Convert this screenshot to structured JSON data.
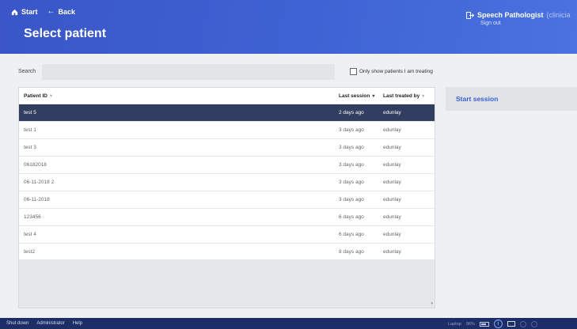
{
  "header": {
    "nav": {
      "start_label": "Start",
      "back_label": "Back"
    },
    "title": "Select patient",
    "user": {
      "name": "Speech Pathologist",
      "role": "(clinicia",
      "signout_label": "Sign out"
    }
  },
  "search": {
    "label": "Search",
    "value": "",
    "placeholder": "",
    "only_mine_label": "Only show patients I am treating",
    "only_mine_checked": false
  },
  "table": {
    "columns": {
      "patient_id": "Patient ID",
      "last_session": "Last session",
      "last_treated_by": "Last treated by"
    },
    "rows": [
      {
        "id": "test 5",
        "last_session": "2 days ago",
        "treated_by": "edunlay",
        "selected": true
      },
      {
        "id": "test 1",
        "last_session": "3 days ago",
        "treated_by": "edunlay"
      },
      {
        "id": "test 3",
        "last_session": "3 days ago",
        "treated_by": "edunlay"
      },
      {
        "id": "06182018",
        "last_session": "3 days ago",
        "treated_by": "edunlay"
      },
      {
        "id": "06-11-2018 2",
        "last_session": "3 days ago",
        "treated_by": "edunlay"
      },
      {
        "id": "06-11-2018",
        "last_session": "3 days ago",
        "treated_by": "edunlay"
      },
      {
        "id": "123456",
        "last_session": "6 days ago",
        "treated_by": "edunlay"
      },
      {
        "id": "test 4",
        "last_session": "6 days ago",
        "treated_by": "edunlay"
      },
      {
        "id": "test2",
        "last_session": "8 days ago",
        "treated_by": "edunlay"
      }
    ]
  },
  "side_panel": {
    "start_session_label": "Start session"
  },
  "taskbar": {
    "items": [
      "Shut down",
      "Administrator",
      "Help"
    ],
    "laptop_label": "Laptop",
    "battery_percent": "96%"
  },
  "colors": {
    "header": "#3f63d4",
    "selected_row": "#323e5f",
    "accent": "#3b5fd1",
    "taskbar": "#1d2e66"
  }
}
